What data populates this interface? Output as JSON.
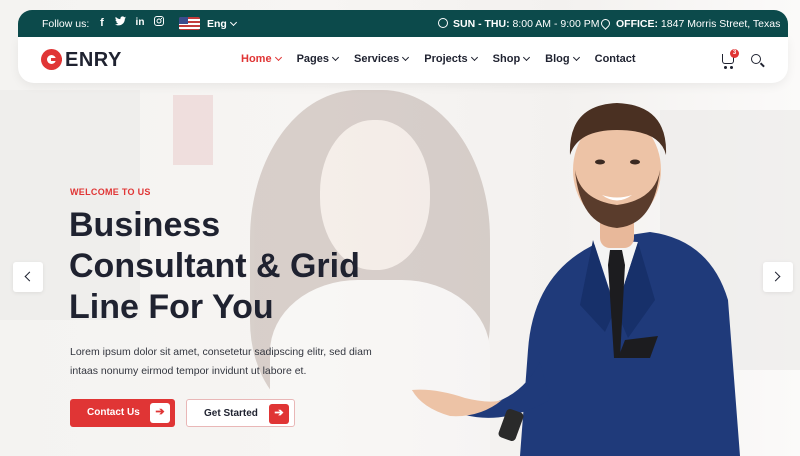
{
  "topbar": {
    "follow_label": "Follow us:",
    "social": [
      "facebook-icon",
      "twitter-icon",
      "linkedin-icon",
      "instagram-icon"
    ],
    "language": "Eng",
    "hours_label": "SUN - THU:",
    "hours_value": "8:00 AM - 9:00 PM",
    "office_label": "OFFICE:",
    "office_value": "1847 Morris Street, Texas",
    "background": "#0c4a4b"
  },
  "navbar": {
    "logo_text": "ENRY",
    "items": [
      {
        "label": "Home",
        "dropdown": true,
        "active": true
      },
      {
        "label": "Pages",
        "dropdown": true,
        "active": false
      },
      {
        "label": "Services",
        "dropdown": true,
        "active": false
      },
      {
        "label": "Projects",
        "dropdown": true,
        "active": false
      },
      {
        "label": "Shop",
        "dropdown": true,
        "active": false
      },
      {
        "label": "Blog",
        "dropdown": true,
        "active": false
      },
      {
        "label": "Contact",
        "dropdown": false,
        "active": false
      }
    ],
    "cart_count": "3",
    "icons": [
      "cart-icon",
      "search-icon"
    ]
  },
  "hero": {
    "eyebrow": "WELCOME TO US",
    "headline_line1": "Business",
    "headline_line2": "Consultant & Grid",
    "headline_line3": "Line For You",
    "description": "Lorem ipsum dolor sit amet, consetetur sadipscing elitr, sed diam intaas nonumy eirmod tempor invidunt ut labore et.",
    "primary_button": "Contact Us",
    "secondary_button": "Get Started"
  },
  "colors": {
    "accent": "#e03535",
    "dark_text": "#1f2230",
    "topbar": "#0c4a4b"
  }
}
